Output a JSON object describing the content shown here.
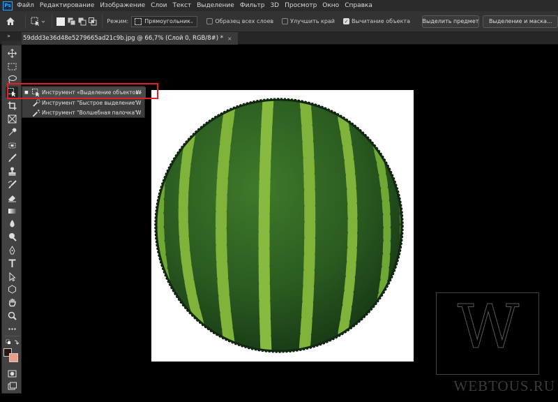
{
  "app": {
    "logo_text": "Ps",
    "menu": [
      "Файл",
      "Редактирование",
      "Изображение",
      "Слои",
      "Текст",
      "Выделение",
      "Фильтр",
      "3D",
      "Просмотр",
      "Окно",
      "Справка"
    ]
  },
  "options_bar": {
    "mode_label": "Режим:",
    "mode_value": "Прямоугольник",
    "sample_all_layers": {
      "label": "Образец всех слоев",
      "checked": false
    },
    "enhance_edge": {
      "label": "Улучшить край",
      "checked": false
    },
    "object_subtract": {
      "label": "Вычитание объекта",
      "checked": true
    },
    "select_subject_button": "Выделить предмет",
    "select_and_mask_button": "Выделение и маска..."
  },
  "document": {
    "tab_title": "59ddd3e36d48e5279665ad21c9b.jpg @ 66,7% (Слой 0, RGB/8#) *",
    "close_glyph": "×"
  },
  "toolbar": {
    "collapse_glyph": "»"
  },
  "flyout": {
    "items": [
      {
        "label": "Инструмент «Выделение объектов»",
        "shortcut": "W",
        "active": true
      },
      {
        "label": "Инструмент \"Быстрое выделение\"",
        "shortcut": "W",
        "active": false
      },
      {
        "label": "Инструмент \"Волшебная палочка\"",
        "shortcut": "W",
        "active": false
      }
    ]
  },
  "colors": {
    "foreground": "#2a1410",
    "background": "#e8a089",
    "highlight_outline": "#e2202a",
    "watermelon_dark": "#1f4a1c",
    "watermelon_light": "#7fb33a"
  },
  "watermark": {
    "letter": "W",
    "site": "WEBTOUS.RU"
  }
}
